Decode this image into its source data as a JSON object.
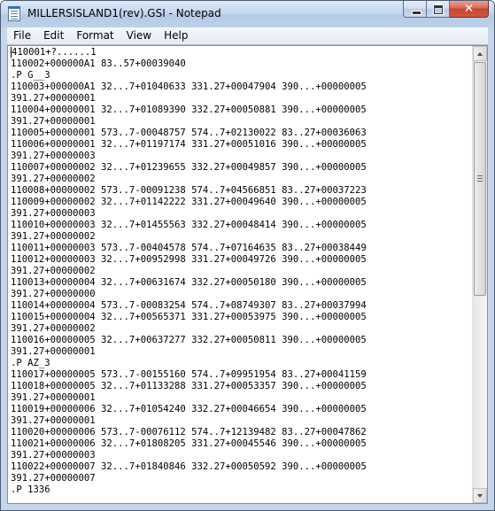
{
  "window": {
    "title": "MILLERSISLAND1(rev).GSI - Notepad",
    "icon": "notepad-icon"
  },
  "caption_buttons": {
    "minimize_icon": "minimize-icon",
    "maximize_icon": "maximize-icon",
    "close_glyph": "✕"
  },
  "menu": {
    "items": [
      {
        "label": "File"
      },
      {
        "label": "Edit"
      },
      {
        "label": "Format"
      },
      {
        "label": "View"
      },
      {
        "label": "Help"
      }
    ]
  },
  "document": {
    "lines": [
      "410001+?......1",
      "110002+000000A1 83..57+00039040",
      ".P G__3",
      "110003+000000A1 32...7+01040633 331.27+00047904 390...+00000005",
      "391.27+00000001",
      "110004+00000001 32...7+01089390 332.27+00050881 390...+00000005",
      "391.27+00000001",
      "110005+00000001 573..7-00048757 574..7+02130022 83..27+00036063",
      "110006+00000001 32...7+01197174 331.27+00051016 390...+00000005",
      "391.27+00000003",
      "110007+00000002 32...7+01239655 332.27+00049857 390...+00000005",
      "391.27+00000002",
      "110008+00000002 573..7-00091238 574..7+04566851 83..27+00037223",
      "110009+00000002 32...7+01142222 331.27+00049640 390...+00000005",
      "391.27+00000003",
      "110010+00000003 32...7+01455563 332.27+00048414 390...+00000005",
      "391.27+00000002",
      "110011+00000003 573..7-00404578 574..7+07164635 83..27+00038449",
      "110012+00000003 32...7+00952998 331.27+00049726 390...+00000005",
      "391.27+00000002",
      "110013+00000004 32...7+00631674 332.27+00050180 390...+00000005",
      "391.27+00000000",
      "110014+00000004 573..7-00083254 574..7+08749307 83..27+00037994",
      "110015+00000004 32...7+00565371 331.27+00053975 390...+00000005",
      "391.27+00000002",
      "110016+00000005 32...7+00637277 332.27+00050811 390...+00000005",
      "391.27+00000001",
      ".P AZ_3",
      "110017+00000005 573..7-00155160 574..7+09951954 83..27+00041159",
      "110018+00000005 32...7+01133288 331.27+00053357 390...+00000005",
      "391.27+00000001",
      "110019+00000006 32...7+01054240 332.27+00046654 390...+00000005",
      "391.27+00000001",
      "110020+00000006 573..7-00076112 574..7+12139482 83..27+00047862",
      "110021+00000006 32...7+01808205 331.27+00045546 390...+00000005",
      "391.27+00000003",
      "110022+00000007 32...7+01840846 332.27+00050592 390...+00000005",
      "391.27+00000007",
      ".P 1336"
    ]
  },
  "scrollbar": {
    "up_icon": "scroll-up-arrow-icon",
    "down_icon": "scroll-down-arrow-icon"
  }
}
